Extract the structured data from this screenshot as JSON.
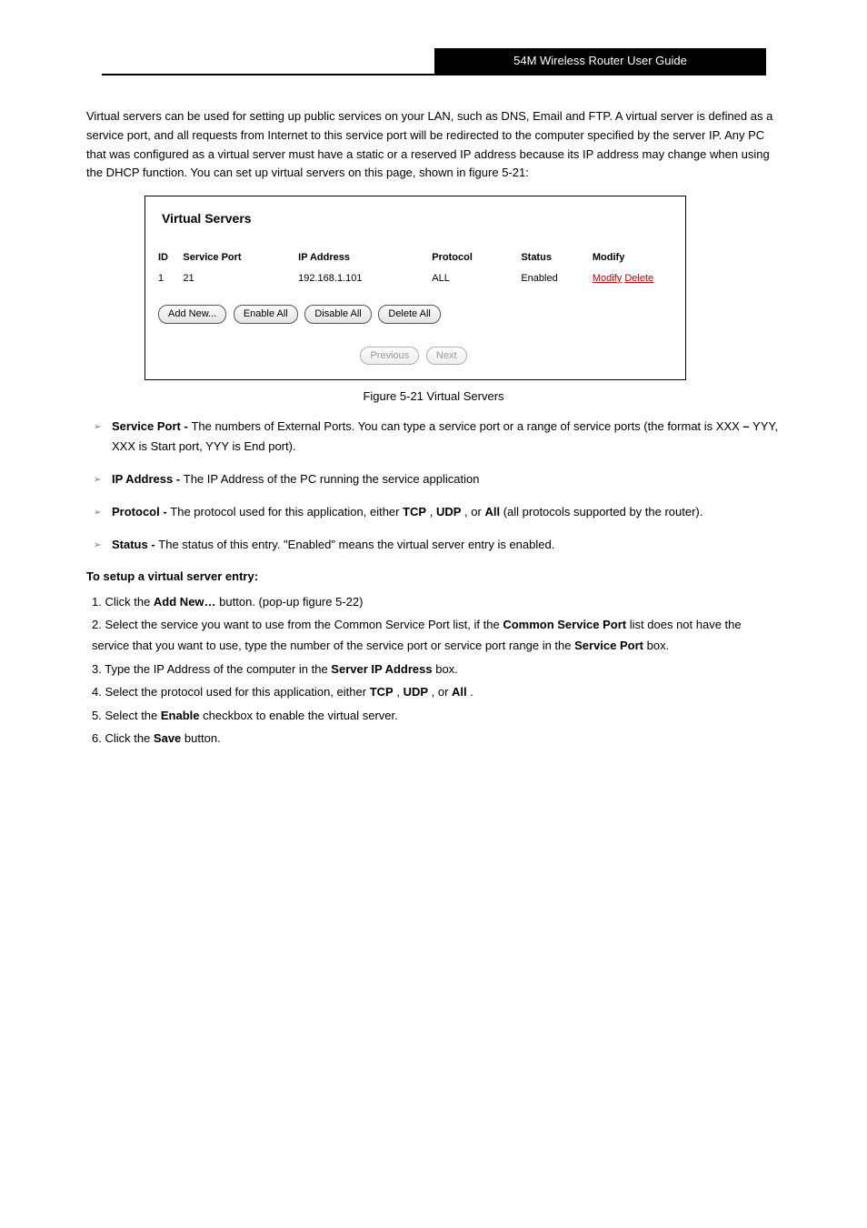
{
  "header": {
    "black_bar_text": "54M Wireless Router User Guide"
  },
  "intro": "Virtual servers can be used for setting up public services on your LAN, such as DNS, Email and FTP. A virtual server is defined as a service port, and all requests from Internet to this service port will be redirected to the computer specified by the server IP. Any PC that was configured as a virtual server must have a static or a reserved IP address because its IP address may change when using the DHCP function. You can set up virtual servers on this page, shown in figure 5-21:",
  "figure": {
    "title": "Virtual Servers",
    "headers": {
      "id": "ID",
      "service_port": "Service Port",
      "ip_address": "IP Address",
      "protocol": "Protocol",
      "status": "Status",
      "modify": "Modify"
    },
    "row": {
      "id": "1",
      "service_port": "21",
      "ip_address": "192.168.1.101",
      "protocol": "ALL",
      "status": "Enabled",
      "modify_link": "Modify",
      "delete_link": "Delete"
    },
    "buttons": {
      "add_new": "Add New...",
      "enable_all": "Enable All",
      "disable_all": "Disable All",
      "delete_all": "Delete All",
      "previous": "Previous",
      "next": "Next"
    },
    "caption": "Figure 5-21 Virtual Servers"
  },
  "bullets": {
    "b1_label": "Service Port - ",
    "b1_text_a": "The numbers of External Ports. You can type a service port or a range of service ports (the format is XXX ",
    "b1_dash": "–",
    "b1_text_b": " YYY, XXX is Start port, YYY is End port). ",
    "b2_label": "IP Address - ",
    "b2_text": "The IP Address of the PC running the service application",
    "b3_label": "Protocol - ",
    "b3_text": "The protocol used for this application, either ",
    "b3_tcp": "TCP",
    "b3_sep1": ",",
    "b3_udp": "UDP",
    "b3_sep2": ", or ",
    "b3_all": "All",
    "b3_text2": " (all protocols supported by the router).",
    "b4_label": "Status - ",
    "b4_text": "The status of this entry. \"Enabled\" means the virtual server entry is enabled."
  },
  "steps": {
    "lead_label": "To setup a virtual server entry: ",
    "s1": "1.  Click the ",
    "s1_btn": "Add New…",
    "s1_tail": " button. (pop-up figure 5-22)",
    "s2": "2.  Select the service you want to use from the Common Service Port list, if the ",
    "s2_label": "Common Service Port",
    "s2_tail1": " list does not have the service that you want to use, type the number of the service port or service port range in the ",
    "s2_label2": "Service Port",
    "s2_tail2": " box.",
    "s3": "3.  Type the IP Address of the computer in the ",
    "s3_label": "Server IP Address",
    "s3_tail": " box. ",
    "s4": "4.  Select the protocol used for this application, either ",
    "s4_tcp": "TCP",
    "s4_sep1": ",",
    "s4_udp": "UDP",
    "s4_sep2": ", or ",
    "s4_all": "All",
    "s4_tail": ". ",
    "s5": "5.  Select the ",
    "s5_label": "Enable",
    "s5_tail": " checkbox to enable the virtual server. ",
    "s6": "6.  Click the ",
    "s6_btn": "Save",
    "s6_tail": " button. "
  }
}
